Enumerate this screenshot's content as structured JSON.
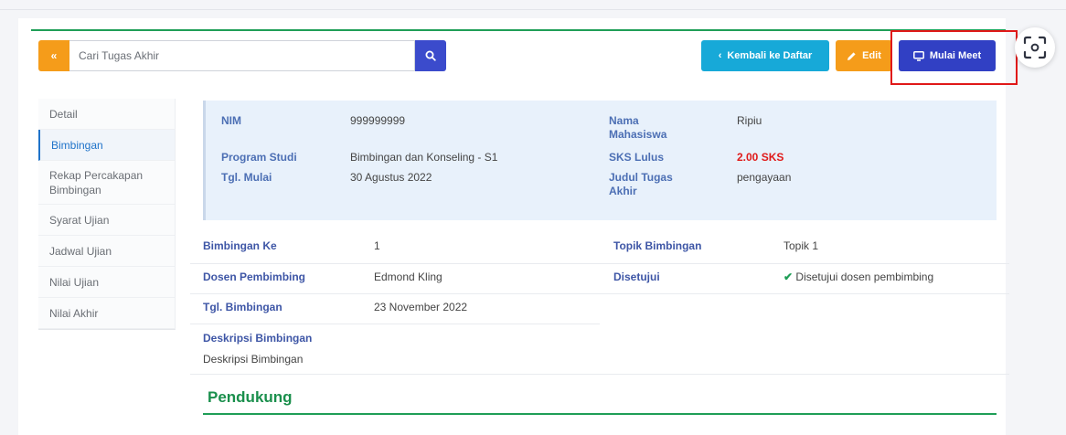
{
  "toolbar": {
    "collapse_icon": "double-chevron-left-icon",
    "search_placeholder": "Cari Tugas Akhir",
    "search_value": "",
    "back_label": "Kembali ke Daftar",
    "edit_label": "Edit",
    "meet_label": "Mulai Meet"
  },
  "sidebar": {
    "items": [
      {
        "label": "Detail",
        "active": false
      },
      {
        "label": "Bimbingan",
        "active": true
      },
      {
        "label": "Rekap Percakapan Bimbingan",
        "active": false
      },
      {
        "label": "Syarat Ujian",
        "active": false
      },
      {
        "label": "Jadwal Ujian",
        "active": false
      },
      {
        "label": "Nilai Ujian",
        "active": false
      },
      {
        "label": "Nilai Akhir",
        "active": false
      }
    ]
  },
  "student": {
    "nim_label": "NIM",
    "nim": "999999999",
    "prodi_label": "Program Studi",
    "prodi": "Bimbingan dan Konseling - S1",
    "tgl_mulai_label": "Tgl. Mulai",
    "tgl_mulai": "30 Agustus 2022",
    "nama_label": "Nama Mahasiswa",
    "nama": "Ripiu",
    "sks_label": "SKS Lulus",
    "sks": "2.00 SKS",
    "judul_label": "Judul Tugas Akhir",
    "judul": "pengayaan"
  },
  "bimbingan": {
    "ke_label": "Bimbingan Ke",
    "ke": "1",
    "topik_label": "Topik Bimbingan",
    "topik": "Topik 1",
    "dosen_label": "Dosen Pembimbing",
    "dosen": "Edmond Kling",
    "disetujui_label": "Disetujui",
    "disetujui": "Disetujui dosen pembimbing",
    "tgl_label": "Tgl. Bimbingan",
    "tgl": "23 November 2022",
    "deskripsi_label": "Deskripsi Bimbingan",
    "deskripsi": "Deskripsi Bimbingan"
  },
  "section": {
    "pendukung": "Pendukung"
  },
  "colors": {
    "green_accent": "#1f9e57",
    "orange": "#f59c1a",
    "blue": "#3140c4",
    "cyan": "#17a9d8",
    "highlight_red": "#e01818"
  }
}
